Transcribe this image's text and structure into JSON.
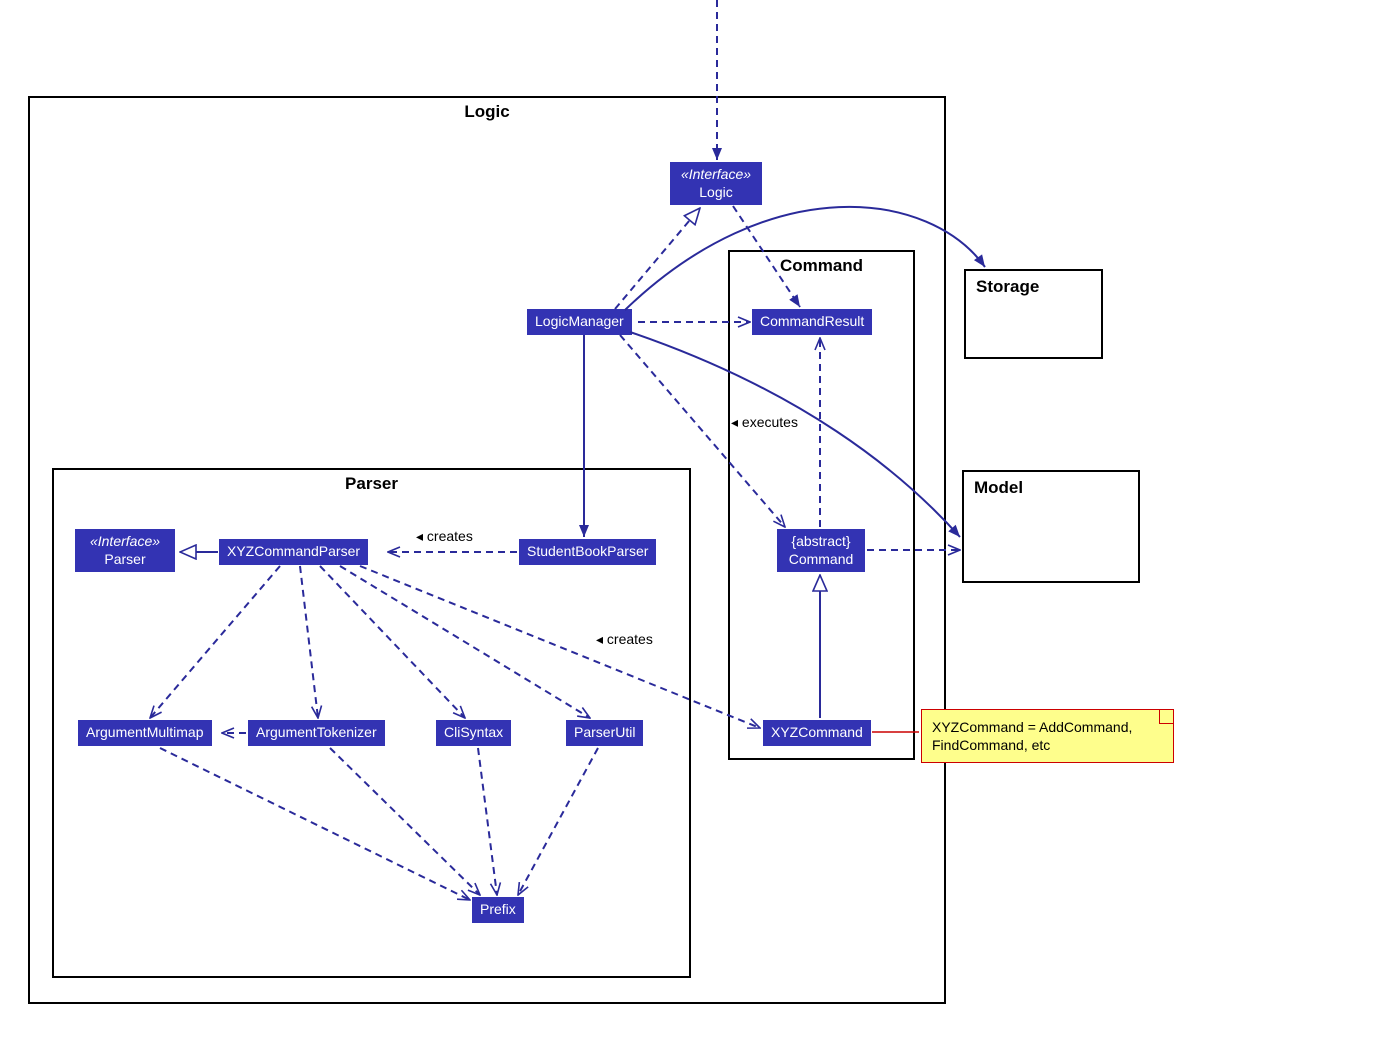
{
  "packages": {
    "logic": "Logic",
    "parser": "Parser",
    "command": "Command"
  },
  "external": {
    "storage": "Storage",
    "model": "Model"
  },
  "nodes": {
    "logicInterface": {
      "stereo": "«Interface»",
      "name": "Logic"
    },
    "logicManager": "LogicManager",
    "parserInterface": {
      "stereo": "«Interface»",
      "name": "Parser"
    },
    "xyzCommandParser": "XYZCommandParser",
    "studentBookParser": "StudentBookParser",
    "argumentMultimap": "ArgumentMultimap",
    "argumentTokenizer": "ArgumentTokenizer",
    "cliSyntax": "CliSyntax",
    "parserUtil": "ParserUtil",
    "prefix": "Prefix",
    "commandResult": "CommandResult",
    "abstractCommand": {
      "stereo": "{abstract}",
      "name": "Command"
    },
    "xyzCommand": "XYZCommand"
  },
  "labels": {
    "creates1": "creates",
    "creates2": "creates",
    "executes": "executes"
  },
  "note": {
    "text": "XYZCommand = AddCommand, FindCommand, etc"
  }
}
